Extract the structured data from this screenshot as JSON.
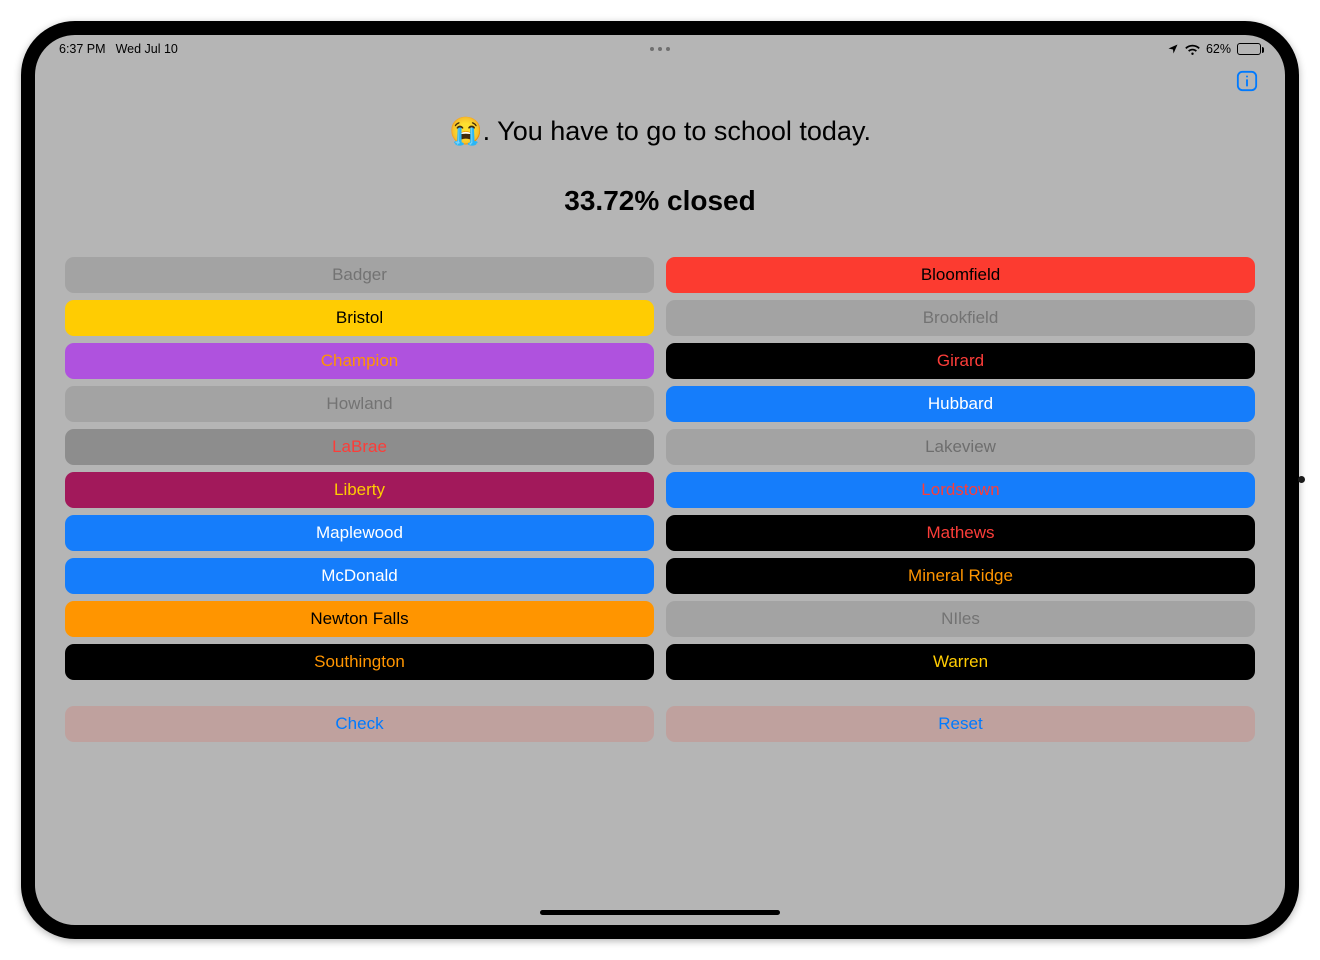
{
  "status": {
    "time": "6:37 PM",
    "date": "Wed Jul 10",
    "battery_pct": "62%"
  },
  "headline": "😭. You have to go to school today.",
  "percent_closed": "33.72% closed",
  "colors": {
    "gray": {
      "bg": "#a3a3a3",
      "fg": "#737373"
    },
    "red": {
      "bg": "#fc3b30",
      "fg": "#000000"
    },
    "yellow": {
      "bg": "#ffcc02",
      "fg": "#000000"
    },
    "purple": {
      "bg": "#af52de",
      "fg": "#ff9500"
    },
    "black_red": {
      "bg": "#000000",
      "fg": "#fc3d39"
    },
    "darkgray": {
      "bg": "#8d8d8d",
      "fg": "#fc3d39"
    },
    "blue": {
      "bg": "#157dfb",
      "fg": "#ffffff"
    },
    "gray2": {
      "bg": "#a3a3a3",
      "fg": "#6e6e6e"
    },
    "maroon": {
      "bg": "#a2195b",
      "fg": "#ffcc02"
    },
    "blue_red": {
      "bg": "#157dfb",
      "fg": "#fc3d39"
    },
    "black_orange": {
      "bg": "#000000",
      "fg": "#ff9500"
    },
    "orange": {
      "bg": "#ff9500",
      "fg": "#000000"
    },
    "black_yellow": {
      "bg": "#000000",
      "fg": "#ffcc02"
    }
  },
  "schools": [
    {
      "name": "Badger",
      "scheme": "gray"
    },
    {
      "name": "Bloomfield",
      "scheme": "red"
    },
    {
      "name": "Bristol",
      "scheme": "yellow"
    },
    {
      "name": "Brookfield",
      "scheme": "gray"
    },
    {
      "name": "Champion",
      "scheme": "purple"
    },
    {
      "name": "Girard",
      "scheme": "black_red"
    },
    {
      "name": "Howland",
      "scheme": "gray"
    },
    {
      "name": "Hubbard",
      "scheme": "blue"
    },
    {
      "name": "LaBrae",
      "scheme": "darkgray"
    },
    {
      "name": "Lakeview",
      "scheme": "gray2"
    },
    {
      "name": "Liberty",
      "scheme": "maroon"
    },
    {
      "name": "Lordstown",
      "scheme": "blue_red"
    },
    {
      "name": "Maplewood",
      "scheme": "blue"
    },
    {
      "name": "Mathews",
      "scheme": "black_red"
    },
    {
      "name": "McDonald",
      "scheme": "blue"
    },
    {
      "name": "Mineral Ridge",
      "scheme": "black_orange"
    },
    {
      "name": "Newton Falls",
      "scheme": "orange"
    },
    {
      "name": "NIles",
      "scheme": "gray"
    },
    {
      "name": "Southington",
      "scheme": "black_orange"
    },
    {
      "name": "Warren",
      "scheme": "black_yellow"
    }
  ],
  "actions": {
    "check": "Check",
    "reset": "Reset"
  }
}
